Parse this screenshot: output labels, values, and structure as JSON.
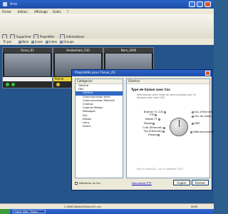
{
  "window": {
    "title": "Aria"
  },
  "menu": [
    "Fichier",
    "Edition",
    "Affichage",
    "Outils",
    "?"
  ],
  "toolbar": {
    "suppress_label": "Supprimer",
    "properties_label": "Propriétés",
    "info_label": "Informations"
  },
  "tabs": [
    "Tri par",
    "Nom",
    "Icone",
    "Index",
    "Groupe"
  ],
  "machines": [
    {
      "name": "Fanuc_01",
      "status": ""
    },
    {
      "name": "Heidenhain_530",
      "status": "Panne"
    },
    {
      "name": "Num_1060",
      "status": ""
    }
  ],
  "dialog": {
    "title": "Propriétés pour Fanuc_01",
    "categories_header": "Catégories",
    "categories": [
      {
        "label": "Général",
        "level": 0,
        "selected": false
      },
      {
        "label": "DNC",
        "level": 0,
        "selected": false
      },
      {
        "label": "Général",
        "level": 1,
        "selected": true
      },
      {
        "label": "Communication série",
        "level": 1,
        "selected": false
      },
      {
        "label": "Communication Ethernet",
        "level": 1,
        "selected": false
      },
      {
        "label": "Champs",
        "level": 1,
        "selected": false
      },
      {
        "label": "Capture Réseau",
        "level": 1,
        "selected": false
      },
      {
        "label": "Messages",
        "level": 1,
        "selected": false
      },
      {
        "label": "DLL",
        "level": 1,
        "selected": false
      },
      {
        "label": "Edition",
        "level": 1,
        "selected": false
      },
      {
        "label": "Liens",
        "level": 1,
        "selected": false
      },
      {
        "label": "Divers",
        "level": 1,
        "selected": false
      }
    ],
    "panel_header": "Général",
    "panel_title": "Type de liaison avec Cnc",
    "panel_desc": "Sélectionnez votre mode de communication pour le dialogue avec votre CNC.",
    "panel_foot": "Pour le mode DLL, voir la catégorie \"DLL\"",
    "options": [
      "Brother TC 22S",
      "FTP",
      "Mazak TT",
      "Mazak",
      "Cnet (Ethernet)",
      "Ftp (Ethernet)",
      "Disque",
      "DLL (Ethernet)",
      "DLL de pilote",
      "DNC",
      "Débranchement"
    ],
    "detach_label": "Détacher la Cnc",
    "doc_link": "Document PTT",
    "copy_label": "Copier",
    "close_label": "Fermer"
  },
  "status": {
    "path": "C:\\DNC\\Atelier\\Fanuc01.cnc",
    "info": "NUM"
  },
  "taskbar": {
    "start": "",
    "window_label": "Fanuc Atm - Fanuc"
  }
}
